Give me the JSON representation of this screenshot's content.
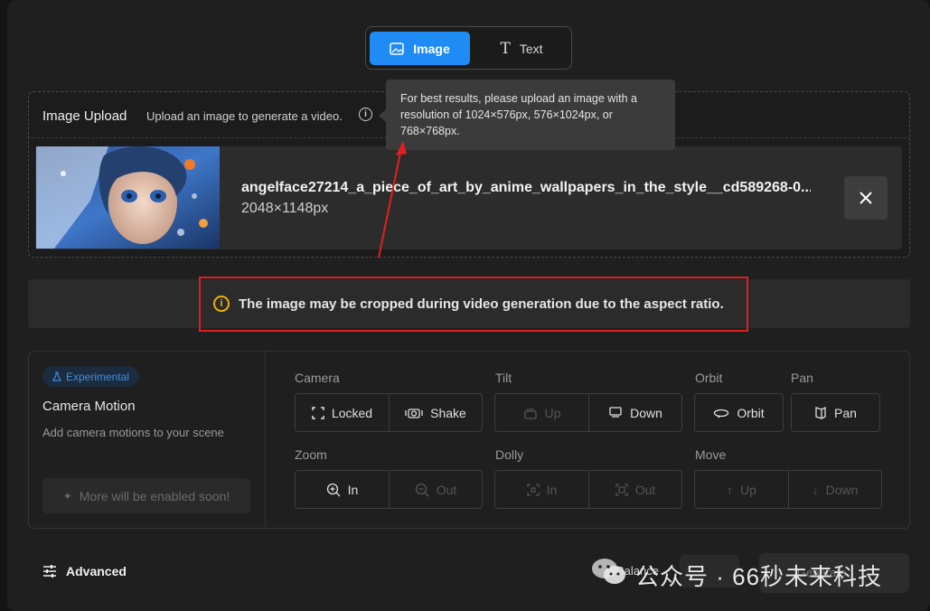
{
  "mode_toggle": {
    "image_label": "Image",
    "text_label": "Text"
  },
  "upload": {
    "title": "Image Upload",
    "subtitle": "Upload an image to generate a video.",
    "tooltip": "For best results, please upload an image with a resolution of 1024×576px, 576×1024px, or 768×768px.",
    "file_name": "angelface27214_a_piece_of_art_by_anime_wallpapers_in_the_style__cd589268-0...",
    "file_size": "2048×1148px"
  },
  "warning": {
    "text": "The image may be cropped during video generation due to the aspect ratio."
  },
  "camera_motion": {
    "badge": "Experimental",
    "title": "Camera Motion",
    "subtitle": "Add camera motions to your scene",
    "more_button": "More will be enabled soon!",
    "camera": {
      "label": "Camera",
      "locked": "Locked",
      "shake": "Shake"
    },
    "tilt": {
      "label": "Tilt",
      "up": "Up",
      "down": "Down"
    },
    "orbit": {
      "label": "Orbit",
      "button": "Orbit"
    },
    "pan": {
      "label": "Pan",
      "button": "Pan"
    },
    "zoom": {
      "label": "Zoom",
      "in": "In",
      "out": "Out"
    },
    "dolly": {
      "label": "Dolly",
      "in": "In",
      "out": "Out"
    },
    "move": {
      "label": "Move",
      "up": "Up",
      "down": "Down"
    }
  },
  "footer": {
    "advanced": "Advanced",
    "balance": "Balance",
    "generate": "Generate",
    "watermark": "公众号 · 66秒未来科技"
  },
  "colors": {
    "accent": "#1f8bf5",
    "warning": "#f0b100",
    "highlight_box": "#e02020",
    "experimental": "#3d8fe8"
  }
}
